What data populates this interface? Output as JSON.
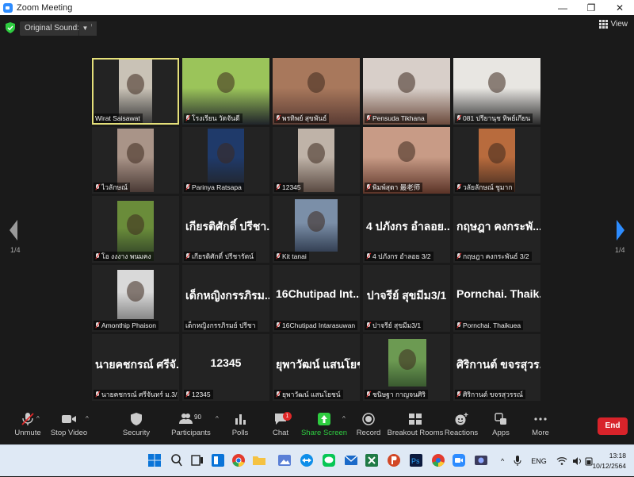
{
  "window": {
    "title": "Zoom Meeting",
    "minimize": "—",
    "restore": "❐",
    "close": "✕"
  },
  "topbar": {
    "original_sound": "Original Sound: Off",
    "view_label": "View"
  },
  "pager": {
    "left": "1/4",
    "right": "1/4"
  },
  "tiles": [
    {
      "caption": "Wirat Saisawat",
      "muted": false,
      "active": true,
      "big": ""
    },
    {
      "caption": "โรงเรียน วัดจันดี",
      "muted": true,
      "big": ""
    },
    {
      "caption": "พรทิพย์ สุขพันธ์",
      "muted": true,
      "big": ""
    },
    {
      "caption": "Pensuda Tikhana",
      "muted": true,
      "big": ""
    },
    {
      "caption": "081 ปรียานุช ทิพย์เกียน",
      "muted": true,
      "big": ""
    },
    {
      "caption": "ไวลักษณ์",
      "muted": true,
      "big": ""
    },
    {
      "caption": "Parinya Ratsapa",
      "muted": true,
      "big": ""
    },
    {
      "caption": "12345",
      "muted": true,
      "big": ""
    },
    {
      "caption": "พิมพ์สุดา 最老师",
      "muted": true,
      "big": ""
    },
    {
      "caption": "วลัยลักษณ์ ชูมาก",
      "muted": true,
      "big": ""
    },
    {
      "caption": "โอ งงงาง พนมคง",
      "muted": true,
      "big": ""
    },
    {
      "caption": "เกียรติศักดิ์ ปรีชารัตน์",
      "muted": true,
      "big": "เกียรติศักดิ์ ปรีชา..."
    },
    {
      "caption": "Kit tanai",
      "muted": true,
      "big": ""
    },
    {
      "caption": "4 ปภังกร อำลอย 3/2",
      "muted": true,
      "big": "4 ปภังกร อำลอย..."
    },
    {
      "caption": "กฤษฎา คงกระพันธ์ 3/2",
      "muted": true,
      "big": "กฤษฎา คงกระพั..."
    },
    {
      "caption": "Amonthip Phaison",
      "muted": true,
      "big": ""
    },
    {
      "caption": "เด็กหญิงกรรภิรมย์ ปรีชา",
      "muted": false,
      "big": "เด็กหญิงกรรภิรม..."
    },
    {
      "caption": "16Chutipad Intarasuwan",
      "muted": true,
      "big": "16Chutipad Int..."
    },
    {
      "caption": "ปาจรีย์ สุขมีม3/1",
      "muted": true,
      "big": "ปาจรีย์ สุขมีม3/1"
    },
    {
      "caption": "Pornchai. Thaikuea",
      "muted": true,
      "big": "Pornchai. Thaik..."
    },
    {
      "caption": "นายคชกรณ์ ศรีจันทร์ ม.3/2 เ...",
      "muted": true,
      "big": "นายคชกรณ์ ศรีจั..."
    },
    {
      "caption": "12345",
      "muted": true,
      "big": "12345"
    },
    {
      "caption": "ยุพาวัฒน์ แสนโยชน์",
      "muted": true,
      "big": "ยุพาวัฒน์ แสนโยชน์"
    },
    {
      "caption": "ชนิษฐา กาญจนศิริ",
      "muted": true,
      "big": ""
    },
    {
      "caption": "ศิริกานต์ ขจรสุวรรณ์",
      "muted": true,
      "big": "ศิริกานต์ ขจรสุวร..."
    }
  ],
  "toolbar": {
    "unmute": "Unmute",
    "stop_video": "Stop Video",
    "security": "Security",
    "participants": "Participants",
    "participants_count": "90",
    "polls": "Polls",
    "chat": "Chat",
    "chat_badge": "1",
    "share_screen": "Share Screen",
    "record": "Record",
    "breakout_rooms": "Breakout Rooms",
    "reactions": "Reactions",
    "apps": "Apps",
    "more": "More",
    "end": "End"
  },
  "taskbar": {
    "lang": "ENG",
    "time": "13:18",
    "date": "10/12/2564"
  },
  "colors": {
    "accent_blue": "#2d8cff",
    "end_red": "#d8232a",
    "share_green": "#2ecc40",
    "active_border": "#e5e07a"
  }
}
